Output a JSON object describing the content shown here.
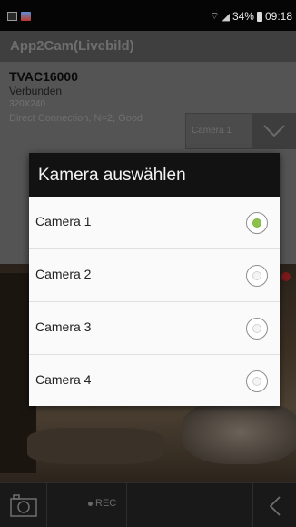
{
  "status_bar": {
    "battery": "34%",
    "time": "09:18"
  },
  "app": {
    "title": "App2Cam(Livebild)"
  },
  "device": {
    "name": "TVAC16000",
    "status": "Verbunden",
    "resolution": "320X240",
    "connection": "Direct Connection, N=2, Good"
  },
  "camera_select": {
    "value": "Camera 1"
  },
  "dialog": {
    "title": "Kamera auswählen",
    "options": [
      {
        "label": "Camera 1",
        "selected": true
      },
      {
        "label": "Camera 2",
        "selected": false
      },
      {
        "label": "Camera 3",
        "selected": false
      },
      {
        "label": "Camera 4",
        "selected": false
      }
    ]
  },
  "toolbar": {
    "rec_label": "REC"
  },
  "icons": {
    "signal": "wifi-signal-icon",
    "snapshot": "camera-icon",
    "back": "chevron-left-icon",
    "dropdown": "chevron-down-icon"
  },
  "colors": {
    "radio_selected": "#8bc34a",
    "dialog_header": "#121212"
  }
}
